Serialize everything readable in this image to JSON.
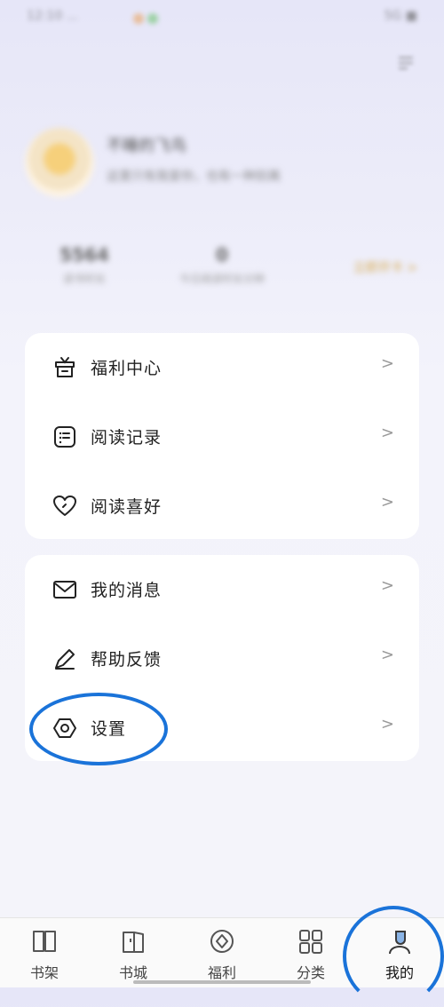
{
  "status_bar": {
    "time": "12:10 ...",
    "right": "5G ■"
  },
  "profile": {
    "name": "不睡的飞鸟",
    "subtitle": "这里只有我爱你，也有一种别离"
  },
  "stats": [
    {
      "value": "5564",
      "label": "读书时长"
    },
    {
      "value": "0",
      "label": "今日阅读时长分钟"
    }
  ],
  "vip_label": "立即开卡 >",
  "menu_group_1": [
    {
      "label": "福利中心",
      "icon": "gift-icon"
    },
    {
      "label": "阅读记录",
      "icon": "reading-record-icon"
    },
    {
      "label": "阅读喜好",
      "icon": "heart-icon"
    }
  ],
  "menu_group_2": [
    {
      "label": "我的消息",
      "icon": "mail-icon"
    },
    {
      "label": "帮助反馈",
      "icon": "pencil-icon"
    },
    {
      "label": "设置",
      "icon": "settings-icon"
    }
  ],
  "chevron": ">",
  "tabs": [
    {
      "label": "书架",
      "icon": "bookshelf-icon"
    },
    {
      "label": "书城",
      "icon": "bookstore-icon"
    },
    {
      "label": "福利",
      "icon": "welfare-icon"
    },
    {
      "label": "分类",
      "icon": "category-icon"
    },
    {
      "label": "我的",
      "icon": "profile-icon",
      "active": true
    }
  ],
  "colors": {
    "accent": "#1a73d9",
    "vip": "#d6a84a",
    "card": "#ffffff"
  }
}
